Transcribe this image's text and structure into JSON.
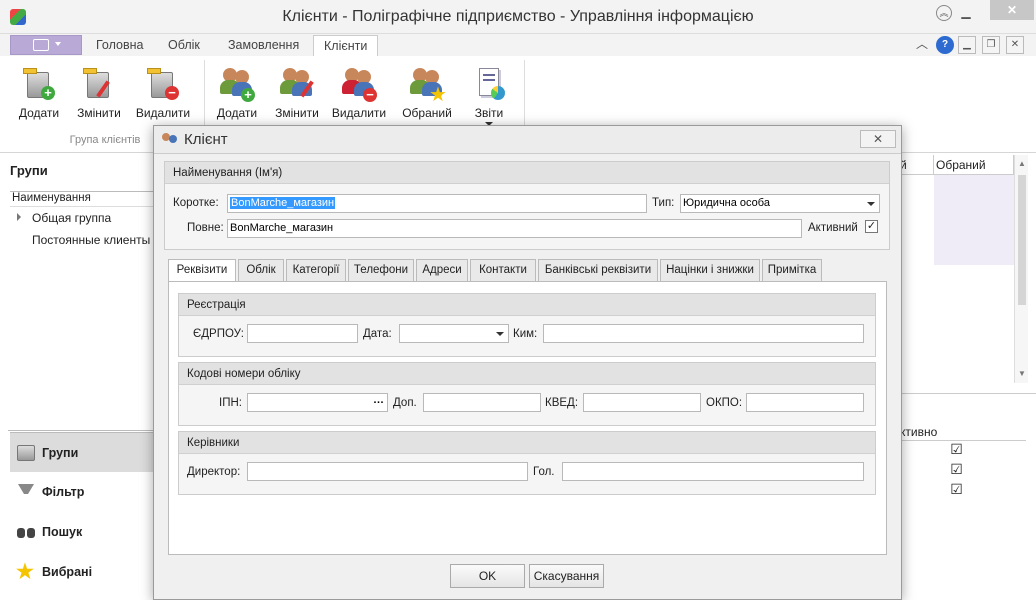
{
  "window": {
    "title": "Клієнти - Поліграфічне підприємство - Управління інформацією"
  },
  "ribbon_tabs": [
    "Головна",
    "Облік",
    "Замовлення",
    "Клієнти"
  ],
  "ribbon": {
    "group_clients_label": "Група клієнтів",
    "group_buttons": [
      "Додати",
      "Змінити",
      "Видалити"
    ],
    "client_buttons": [
      "Додати",
      "Змінити",
      "Видалити",
      "Обраний",
      "Звіти"
    ]
  },
  "left": {
    "title": "Групи",
    "column_header": "Наименування",
    "tree": [
      "Общая группа",
      "Постоянные клиенты"
    ],
    "nav": [
      "Групи",
      "Фільтр",
      "Пошук",
      "Вибрані"
    ]
  },
  "right_grid": {
    "headers": [
      "й",
      "Обраний"
    ],
    "bottom_header": "ктивно"
  },
  "dialog": {
    "title": "Клієнт",
    "name_group": "Найменування (Ім'я)",
    "short_label": "Коротке:",
    "short_value": "BonMarche_магазин",
    "type_label": "Тип:",
    "type_value": "Юридична особа",
    "full_label": "Повне:",
    "full_value": "BonMarche_магазин",
    "active_label": "Активний",
    "active_checked": true,
    "tabs": [
      "Реквізити",
      "Облік",
      "Категорії",
      "Телефони",
      "Адреси",
      "Контакти",
      "Банківські реквізити",
      "Націнки і знижки",
      "Примітка"
    ],
    "active_tab": 0,
    "registration": {
      "title": "Реєстрація",
      "edrpou_label": "ЄДРПОУ:",
      "edrpou_value": "",
      "date_label": "Дата:",
      "date_value": "",
      "by_label": "Ким:",
      "by_value": ""
    },
    "codes": {
      "title": "Кодові номери обліку",
      "ipn_label": "ІПН:",
      "ipn_value": "",
      "ipn_more": "…",
      "dop_label": "Доп.",
      "dop_value": "",
      "kved_label": "КВЕД:",
      "kved_value": "",
      "okpo_label": "ОКПО:",
      "okpo_value": ""
    },
    "managers": {
      "title": "Керівники",
      "director_label": "Директор:",
      "director_value": "",
      "chief_label": "Гол.",
      "chief_value": ""
    },
    "ok_label": "OK",
    "cancel_label": "Скасування"
  }
}
